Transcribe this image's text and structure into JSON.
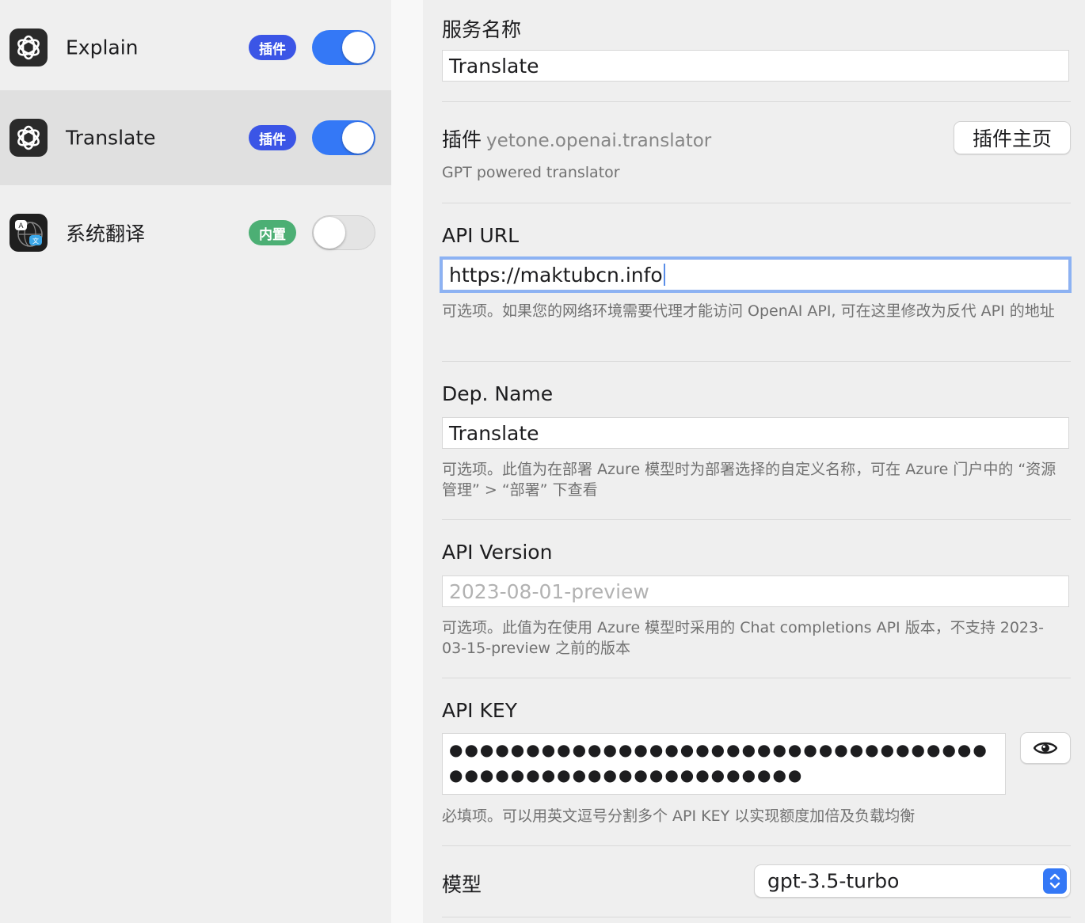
{
  "sidebar": {
    "services": [
      {
        "name": "Explain",
        "badge": "插件",
        "badge_type": "plugin",
        "enabled": true,
        "selected": false,
        "icon": "openai-icon"
      },
      {
        "name": "Translate",
        "badge": "插件",
        "badge_type": "plugin",
        "enabled": true,
        "selected": true,
        "icon": "openai-icon"
      },
      {
        "name": "系统翻译",
        "badge": "内置",
        "badge_type": "builtin",
        "enabled": false,
        "selected": false,
        "icon": "system-translate-icon"
      }
    ]
  },
  "form": {
    "service_name": {
      "label": "服务名称",
      "value": "Translate"
    },
    "plugin": {
      "label": "插件",
      "id": "yetone.openai.translator",
      "description": "GPT powered translator",
      "homepage_button": "插件主页"
    },
    "api_url": {
      "label": "API URL",
      "value": "https://maktubcn.info",
      "hint": "可选项。如果您的网络环境需要代理才能访问 OpenAI API, 可在这里修改为反代 API 的地址"
    },
    "dep_name": {
      "label": "Dep. Name",
      "value": "Translate",
      "hint": "可选项。此值为在部署 Azure 模型时为部署选择的自定义名称，可在 Azure 门户中的 “资源管理” > “部署” 下查看"
    },
    "api_version": {
      "label": "API Version",
      "placeholder": "2023-08-01-preview",
      "hint": "可选项。此值为在使用 Azure 模型时采用的 Chat completions API 版本，不支持 2023-03-15-preview 之前的版本"
    },
    "api_key": {
      "label": "API KEY",
      "masked_value": "●●●●●●●●●●●●●●●●●●●●●●●●●●●●●●●●●●●●●●●●●●●●●●●●●●●●●●●●●●",
      "reveal_icon": "eye-icon",
      "hint": "必填项。可以用英文逗号分割多个 API KEY 以实现额度加倍及负载均衡"
    },
    "model": {
      "label": "模型",
      "value": "gpt-3.5-turbo"
    }
  },
  "colors": {
    "accent": "#3478f6",
    "plugin_badge": "#3b55e6",
    "builtin_badge": "#4caf74"
  }
}
